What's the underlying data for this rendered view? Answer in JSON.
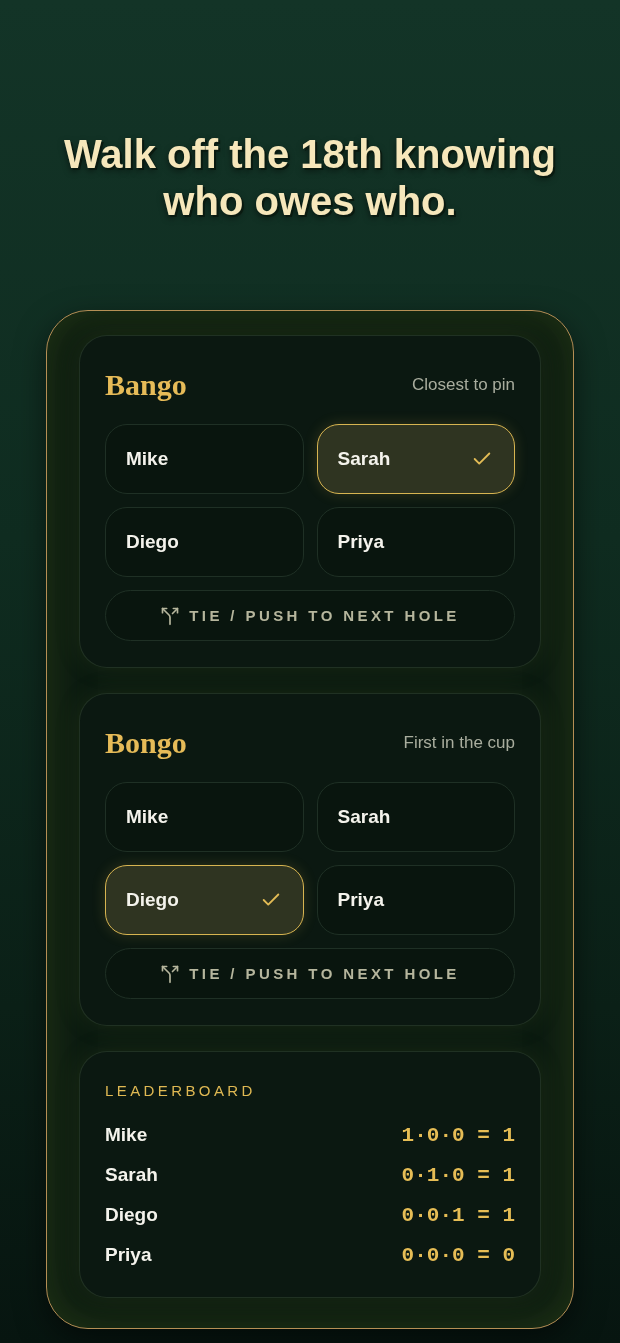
{
  "headline": "Walk off the 18th knowing who owes who.",
  "games": [
    {
      "title": "Bango",
      "subtitle": "Closest to pin",
      "players": [
        {
          "name": "Mike",
          "selected": false
        },
        {
          "name": "Sarah",
          "selected": true
        },
        {
          "name": "Diego",
          "selected": false
        },
        {
          "name": "Priya",
          "selected": false
        }
      ],
      "tie_button": "TIE / PUSH TO NEXT HOLE"
    },
    {
      "title": "Bongo",
      "subtitle": "First in the cup",
      "players": [
        {
          "name": "Mike",
          "selected": false
        },
        {
          "name": "Sarah",
          "selected": false
        },
        {
          "name": "Diego",
          "selected": true
        },
        {
          "name": "Priya",
          "selected": false
        }
      ],
      "tie_button": "TIE / PUSH TO NEXT HOLE"
    }
  ],
  "leaderboard": {
    "title": "LEADERBOARD",
    "rows": [
      {
        "name": "Mike",
        "score": "1·0·0 = 1"
      },
      {
        "name": "Sarah",
        "score": "0·1·0 = 1"
      },
      {
        "name": "Diego",
        "score": "0·0·1 = 1"
      },
      {
        "name": "Priya",
        "score": "0·0·0 = 0"
      }
    ]
  }
}
